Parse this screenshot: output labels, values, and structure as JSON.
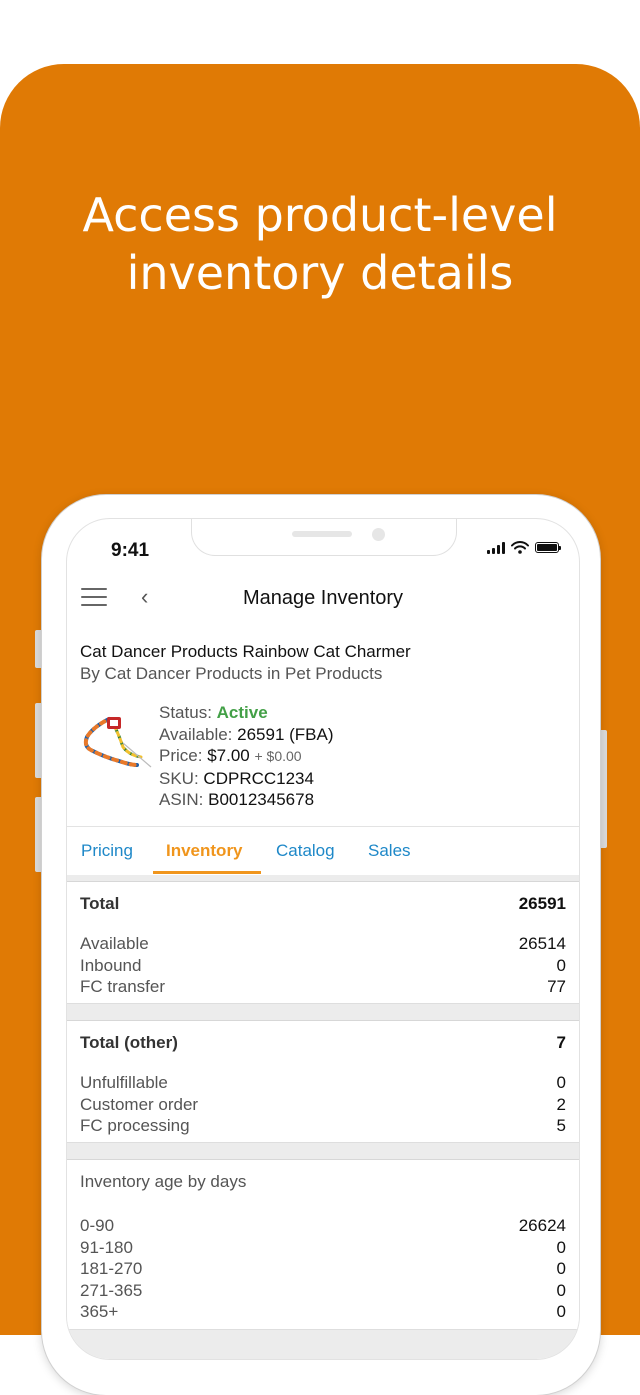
{
  "headline": {
    "line1": "Access product-level",
    "line2": "inventory details"
  },
  "status_bar": {
    "time": "9:41"
  },
  "nav": {
    "title": "Manage Inventory"
  },
  "product": {
    "title": "Cat Dancer Products Rainbow Cat Charmer",
    "subtitle": "By Cat Dancer Products in Pet Products",
    "status_label": "Status:",
    "status_value": "Active",
    "available_label": "Available:",
    "available_value": "26591 (FBA)",
    "price_label": "Price:",
    "price_value": "$7.00",
    "price_extra": "+ $0.00",
    "sku_label": "SKU:",
    "sku_value": "CDPRCC1234",
    "asin_label": "ASIN:",
    "asin_value": "B0012345678"
  },
  "tabs": [
    "Pricing",
    "Inventory",
    "Catalog",
    "Sales"
  ],
  "active_tab": "Inventory",
  "sections": {
    "total": {
      "label": "Total",
      "value": "26591",
      "rows": [
        {
          "label": "Available",
          "value": "26514"
        },
        {
          "label": "Inbound",
          "value": "0"
        },
        {
          "label": "FC transfer",
          "value": "77"
        }
      ]
    },
    "total_other": {
      "label": "Total (other)",
      "value": "7",
      "rows": [
        {
          "label": "Unfulfillable",
          "value": "0"
        },
        {
          "label": "Customer order",
          "value": "2"
        },
        {
          "label": "FC processing",
          "value": "5"
        }
      ]
    },
    "age": {
      "label": "Inventory age by days",
      "rows": [
        {
          "label": "0-90",
          "value": "26624"
        },
        {
          "label": "91-180",
          "value": "0"
        },
        {
          "label": "181-270",
          "value": "0"
        },
        {
          "label": "271-365",
          "value": "0"
        },
        {
          "label": "365+",
          "value": "0"
        }
      ]
    }
  },
  "colors": {
    "background": "#e07a05",
    "active_tab": "#f0951c",
    "link_tab": "#1e88c8",
    "status_active": "#43a047"
  },
  "icons": [
    "menu-icon",
    "back-icon",
    "signal-icon",
    "wifi-icon",
    "battery-icon"
  ]
}
